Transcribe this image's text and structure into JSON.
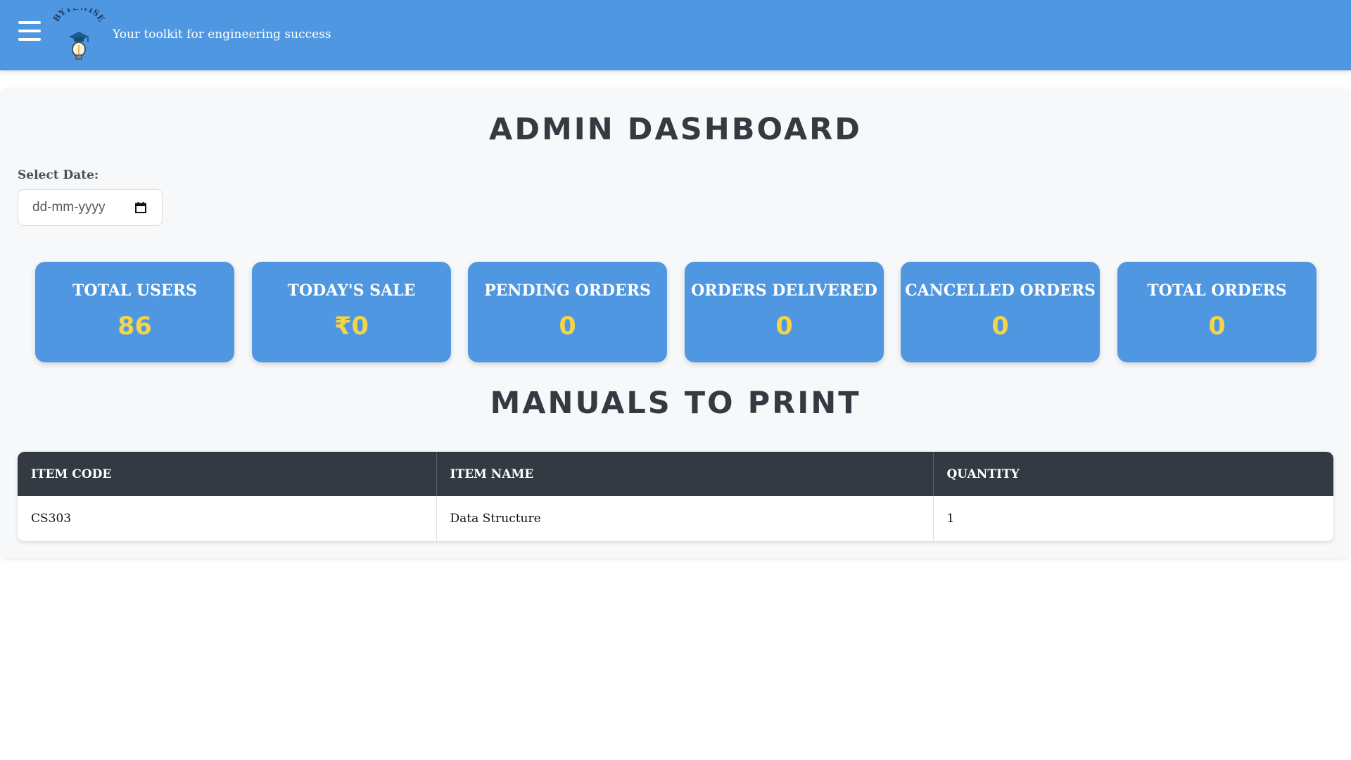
{
  "header": {
    "menu_icon": "hamburger-menu-icon",
    "logo_text": "BYTEWISE",
    "tagline": "Your toolkit for engineering success",
    "accent_color": "#4f98e1"
  },
  "main": {
    "title": "ADMIN DASHBOARD",
    "date_filter": {
      "label": "Select Date:",
      "placeholder": "dd-mm-yyyy",
      "icon": "calendar-icon"
    },
    "stats": [
      {
        "title": "TOTAL USERS",
        "value": "86"
      },
      {
        "title": "TODAY'S SALE",
        "value": "₹0"
      },
      {
        "title": "PENDING ORDERS",
        "value": "0"
      },
      {
        "title": "ORDERS DELIVERED",
        "value": "0"
      },
      {
        "title": "CANCELLED ORDERS",
        "value": "0"
      },
      {
        "title": "TOTAL ORDERS",
        "value": "0"
      }
    ],
    "value_color": "#f5d547",
    "manuals": {
      "title": "MANUALS TO PRINT",
      "columns": [
        "ITEM CODE",
        "ITEM NAME",
        "QUANTITY"
      ],
      "rows": [
        [
          "CS303",
          "Data Structure",
          "1"
        ]
      ]
    }
  }
}
